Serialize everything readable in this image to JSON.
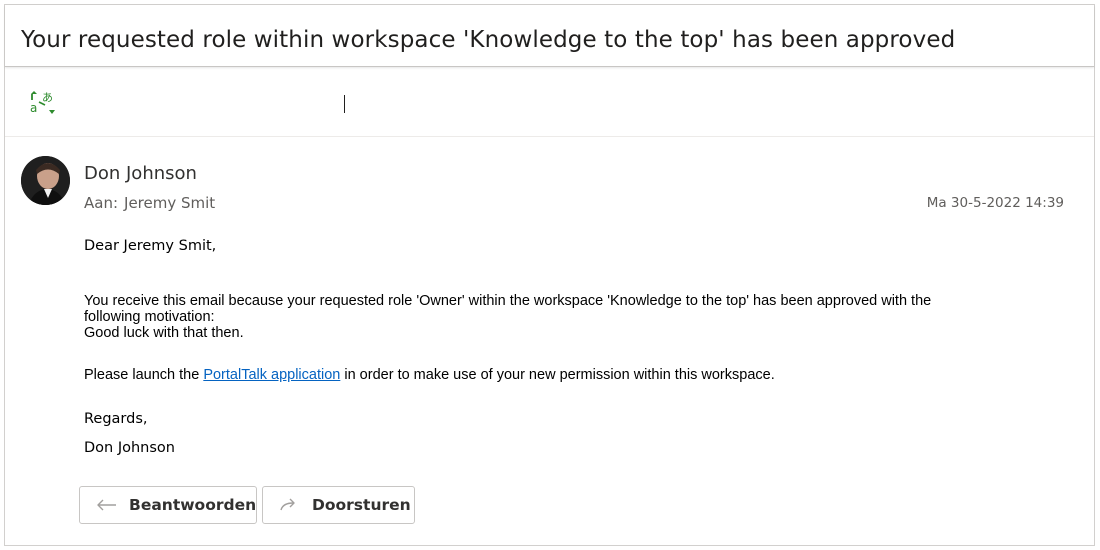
{
  "email": {
    "subject": "Your requested role within workspace 'Knowledge to the top' has been approved",
    "sender": {
      "name": "Don Johnson"
    },
    "recipient": {
      "label": "Aan:",
      "name": "Jeremy Smit"
    },
    "datetime": "Ma 30-5-2022 14:39",
    "body": {
      "greeting": "Dear Jeremy Smit,",
      "paragraph_line1": "You receive this email because your requested role 'Owner' within the workspace 'Knowledge to the top' has been approved with the",
      "paragraph_line2": "following motivation:",
      "paragraph_line3": "Good luck with that then.",
      "launch_before": "Please launch the ",
      "launch_link": "PortalTalk application",
      "launch_after": " in order to make use of your new permission within this workspace.",
      "regards": "Regards,",
      "signature": "Don Johnson"
    }
  },
  "actions": {
    "reply_label": "Beantwoorden",
    "forward_label": "Doorsturen"
  },
  "icons": {
    "translate": "translate-icon",
    "reply": "reply-arrow-icon",
    "forward": "forward-arrow-icon",
    "avatar": "avatar"
  },
  "colors": {
    "link": "#0563c1",
    "translate_icon": "#2e8b2e",
    "secondary_text": "#605e5c"
  }
}
